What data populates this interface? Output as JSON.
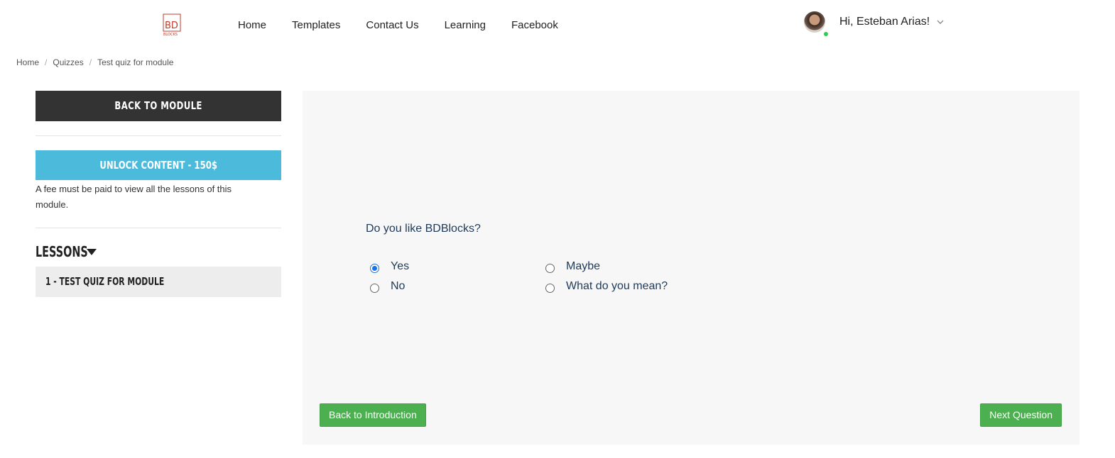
{
  "header": {
    "logo_text": "BD BLOCKS",
    "nav": [
      "Home",
      "Templates",
      "Contact Us",
      "Learning",
      "Facebook"
    ],
    "greeting": "Hi, Esteban Arias!"
  },
  "breadcrumb": [
    "Home",
    "Quizzes",
    "Test quiz for module"
  ],
  "sidebar": {
    "back_to_module": "BACK TO MODULE",
    "unlock": "UNLOCK CONTENT - 150$",
    "fee_note": "A fee must be paid to view all the lessons of this module.",
    "lessons_title": "LESSONS",
    "lessons": [
      "1 - TEST QUIZ FOR MODULE"
    ]
  },
  "quiz": {
    "question": "Do you like BDBlocks?",
    "options": [
      {
        "label": "Yes",
        "selected": true
      },
      {
        "label": "Maybe",
        "selected": false
      },
      {
        "label": "No",
        "selected": false
      },
      {
        "label": "What do you mean?",
        "selected": false
      }
    ],
    "back_label": "Back to Introduction",
    "next_label": "Next Question"
  },
  "colors": {
    "dark_button": "#333333",
    "unlock_button": "#4bbadb",
    "green_button": "#4caf50",
    "online": "#2ecc52",
    "logo": "#c0392b"
  }
}
